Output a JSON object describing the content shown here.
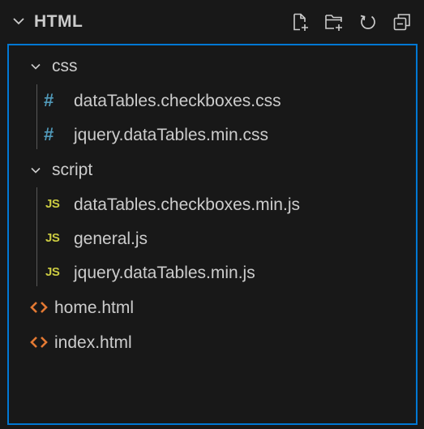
{
  "header": {
    "title": "HTML",
    "actions": [
      {
        "name": "new-file-icon"
      },
      {
        "name": "new-folder-icon"
      },
      {
        "name": "refresh-icon"
      },
      {
        "name": "collapse-all-icon"
      }
    ]
  },
  "tree": {
    "items": [
      {
        "label": "css",
        "type": "folder",
        "expanded": true,
        "depth": 0,
        "icon": "chevron-down-icon"
      },
      {
        "label": "dataTables.checkboxes.css",
        "type": "file",
        "depth": 1,
        "icon": "css-file-icon"
      },
      {
        "label": "jquery.dataTables.min.css",
        "type": "file",
        "depth": 1,
        "icon": "css-file-icon"
      },
      {
        "label": "script",
        "type": "folder",
        "expanded": true,
        "depth": 0,
        "icon": "chevron-down-icon"
      },
      {
        "label": "dataTables.checkboxes.min.js",
        "type": "file",
        "depth": 1,
        "icon": "js-file-icon"
      },
      {
        "label": "general.js",
        "type": "file",
        "depth": 1,
        "icon": "js-file-icon"
      },
      {
        "label": "jquery.dataTables.min.js",
        "type": "file",
        "depth": 1,
        "icon": "js-file-icon"
      },
      {
        "label": "home.html",
        "type": "file",
        "depth": 0,
        "icon": "html-file-icon"
      },
      {
        "label": "index.html",
        "type": "file",
        "depth": 0,
        "icon": "html-file-icon"
      }
    ],
    "icon_glyphs": {
      "css": "#",
      "js": "JS"
    }
  },
  "colors": {
    "background": "#181818",
    "text": "#cccccc",
    "focus_border": "#0078d4",
    "css_icon": "#519aba",
    "js_icon": "#cbcb41",
    "html_icon": "#e37933",
    "indent_guide": "#585858"
  }
}
